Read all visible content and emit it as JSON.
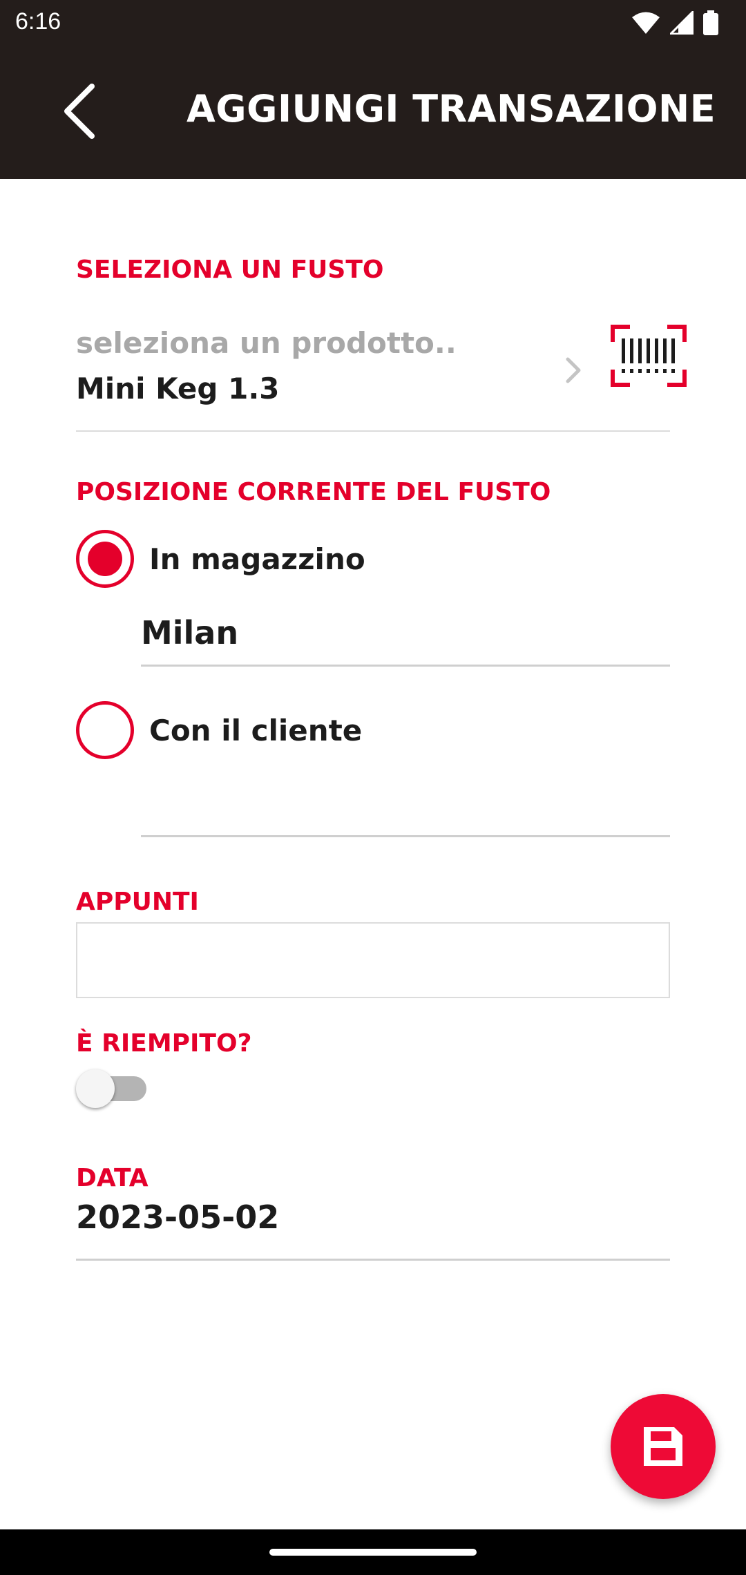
{
  "status_bar": {
    "time": "6:16",
    "icons": [
      "wifi-icon",
      "signal-icon",
      "battery-icon"
    ]
  },
  "app_bar": {
    "title": "AGGIUNGI TRANSAZIONE",
    "back_icon": "chevron-left-icon",
    "background": "#241d1b"
  },
  "form": {
    "keg_section": {
      "label": "SELEZIONA UN FUSTO",
      "placeholder": "seleziona un prodotto..",
      "selected_product": "Mini Keg 1.3",
      "scan_icon": "barcode-scan-icon"
    },
    "position_section": {
      "label": "POSIZIONE CORRENTE DEL FUSTO",
      "options": [
        {
          "label": "In magazzino",
          "checked": true,
          "field_value": "Milan"
        },
        {
          "label": "Con il cliente",
          "checked": false,
          "field_value": ""
        }
      ]
    },
    "notes_section": {
      "label": "APPUNTI",
      "value": ""
    },
    "filled_section": {
      "label": "È RIEMPITO?",
      "toggle_on": false
    },
    "date_section": {
      "label": "DATA",
      "value": "2023-05-02"
    }
  },
  "fab": {
    "icon": "save-icon"
  },
  "colors": {
    "accent": "#e4002b",
    "fab": "#ee0a36",
    "text": "#1c1c1c",
    "placeholder": "#a8a8a8"
  }
}
